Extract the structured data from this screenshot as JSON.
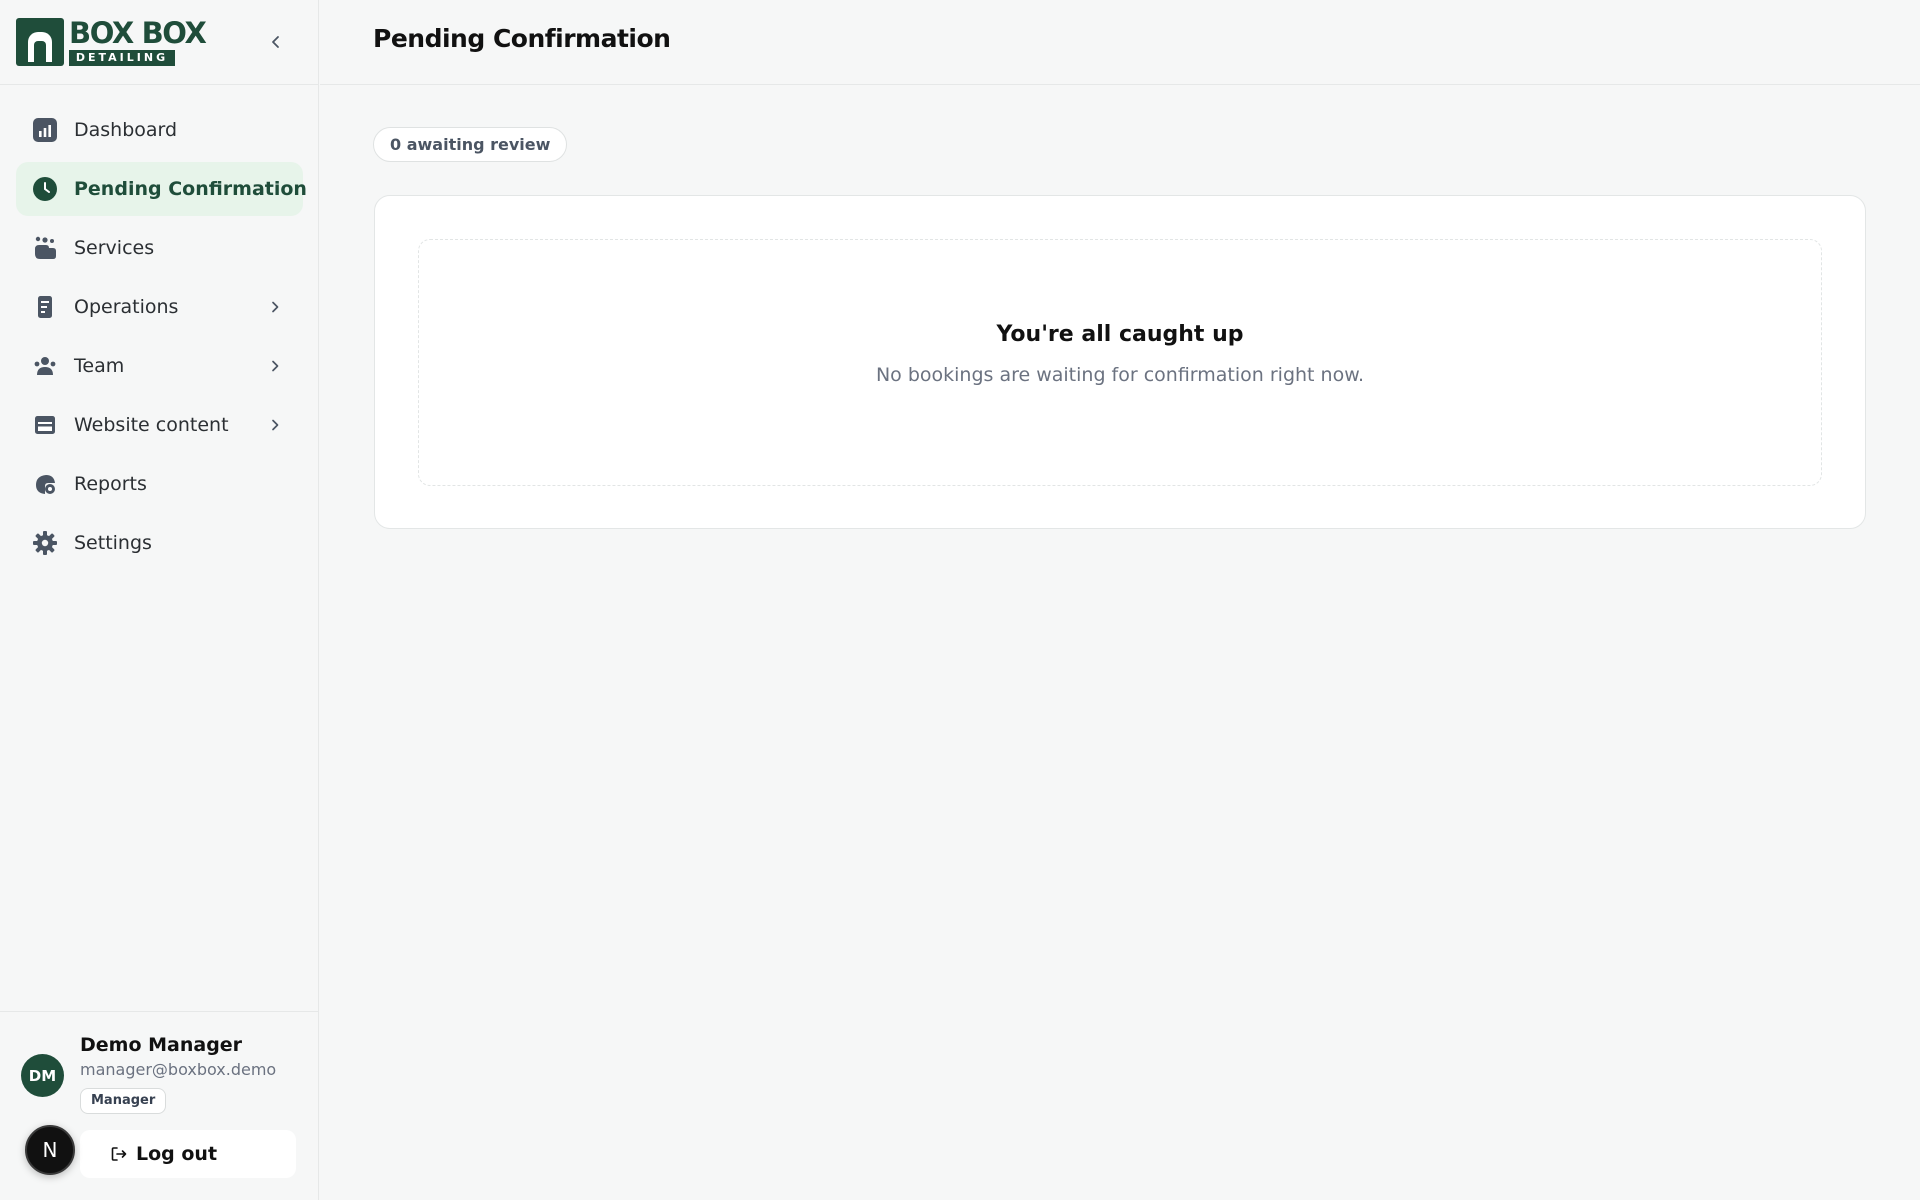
{
  "brand": {
    "logo_word": "BOX BOX",
    "logo_sub": "DETAILING",
    "color": "#1f4d3a"
  },
  "sidebar": {
    "collapse_icon": "chevron-left-icon",
    "items": [
      {
        "label": "Dashboard",
        "icon": "bar-chart-icon",
        "active": false,
        "has_submenu": false
      },
      {
        "label": "Pending Confirmation",
        "icon": "clock-icon",
        "active": true,
        "has_submenu": false
      },
      {
        "label": "Services",
        "icon": "hand-sparkle-icon",
        "active": false,
        "has_submenu": false
      },
      {
        "label": "Operations",
        "icon": "document-icon",
        "active": false,
        "has_submenu": true
      },
      {
        "label": "Team",
        "icon": "team-icon",
        "active": false,
        "has_submenu": true
      },
      {
        "label": "Website content",
        "icon": "browser-window-icon",
        "active": false,
        "has_submenu": true
      },
      {
        "label": "Reports",
        "icon": "reports-icon",
        "active": false,
        "has_submenu": false
      },
      {
        "label": "Settings",
        "icon": "gear-icon",
        "active": false,
        "has_submenu": false
      }
    ]
  },
  "user": {
    "initials": "DM",
    "name": "Demo Manager",
    "email": "manager@boxbox.demo",
    "role": "Manager",
    "logout_label": "Log out"
  },
  "floating_badge": "N",
  "header": {
    "title": "Pending Confirmation"
  },
  "main": {
    "count_label": "0 awaiting review",
    "empty_title": "You're all caught up",
    "empty_text": "No bookings are waiting for confirmation right now."
  },
  "colors": {
    "accent": "#1f4d3a",
    "active_bg": "#e7f4ea",
    "page_bg": "#f6f7f7"
  }
}
